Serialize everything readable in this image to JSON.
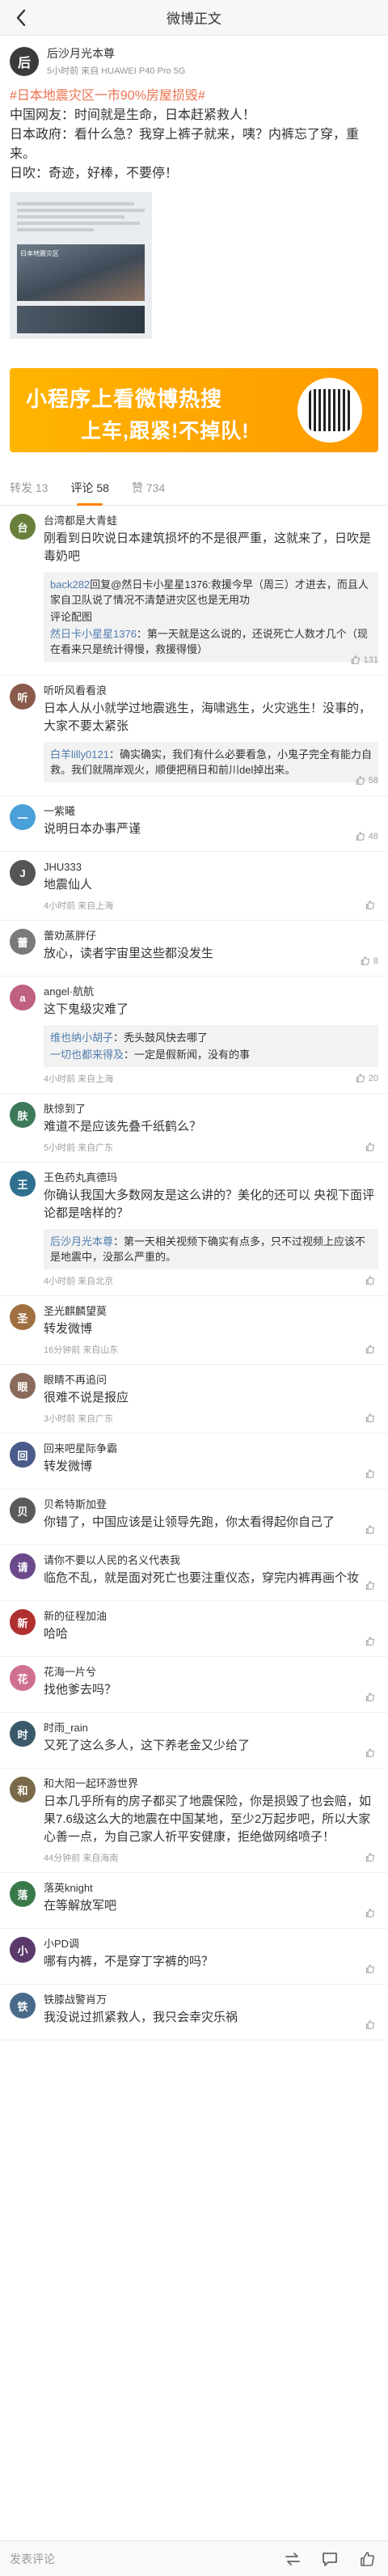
{
  "nav": {
    "title": "微博正文"
  },
  "post": {
    "author": "后沙月光本尊",
    "avatar_color": "#3b3b3b",
    "meta": "5小时前 来自 HUAWEI P40 Pro 5G",
    "hashtag": "#日本地震灾区一市90%房屋损毁#",
    "lines": [
      "中国网友：时间就是生命，日本赶紧救人！",
      "日本政府：看什么急？我穿上裤子就来，咦？内裤忘了穿，重来。",
      "日吹：奇迹，好棒，不要停！"
    ],
    "image_label": "日本地震灾区"
  },
  "banner": {
    "line1": "小程序上看微博热搜",
    "line2": "上车,跟紧!不掉队!"
  },
  "tabs": [
    {
      "label": "转发 13"
    },
    {
      "label": "评论 58"
    },
    {
      "label": "赞 734"
    }
  ],
  "comments": [
    {
      "name": "台湾都是大青蛙",
      "avatar": "#6a7f3c",
      "text": "刚看到日吹说日本建筑损坏的不是很严重，这就来了，日吹是毒奶吧",
      "time": "",
      "like": "131",
      "replies": [
        {
          "name": "back282",
          "text": "回复@然日卡小星星1376:救援今早（周三）才进去，而且人家自卫队说了情况不清楚进灾区也是无用功"
        },
        {
          "name": "",
          "text": "评论配图"
        },
        {
          "name": "然日卡小星星1376",
          "text": "：第一天就是这么说的，还说死亡人数才几个（现在看来只是统计得慢，救援得慢）"
        }
      ]
    },
    {
      "name": "听听风看看浪",
      "avatar": "#8a5a4a",
      "text": "日本人从小就学过地震逃生，海啸逃生，火灾逃生！没事的，大家不要太紧张",
      "time": "",
      "like": "58",
      "replies": [
        {
          "name": "白羊lilly0121",
          "text": "：确实确实，我们有什么必要看急，小鬼子完全有能力自救。我们就隔岸观火，顺便把稍日和前川del掉出来。"
        }
      ]
    },
    {
      "name": "一紫曦",
      "avatar": "#4aa0d8",
      "text": "说明日本办事严谨",
      "time": "",
      "like": "48",
      "replies": []
    },
    {
      "name": "JHU333",
      "avatar": "#555555",
      "text": "地震仙人",
      "time": "4小时前 来自上海",
      "like": "",
      "replies": []
    },
    {
      "name": "蕾劝蒸胖仔",
      "avatar": "#7a7a7a",
      "text": "放心，读者宇宙里这些都没发生",
      "time": "",
      "like": "8",
      "replies": []
    },
    {
      "name": "angel·航航",
      "avatar": "#c06080",
      "text": "这下鬼级灾难了",
      "time": "4小时前 来自上海",
      "like": "20",
      "replies": [
        {
          "name": "维也纳小胡子",
          "text": "：秃头鼓风快去哪了"
        },
        {
          "name": "一切也都来得及",
          "text": "：一定是假新闻，没有的事"
        }
      ]
    },
    {
      "name": "肤惊到了",
      "avatar": "#3c7a5a",
      "text": "难道不是应该先叠千纸鹤么？",
      "time": "5小时前 来自广东",
      "like": "",
      "replies": []
    },
    {
      "name": "王色药丸真德玛",
      "avatar": "#2f6f8f",
      "text": "你确认我国大多数网友是这么讲的？美化的还可以 央视下面评论都是啥样的？",
      "time": "4小时前 来自北京",
      "like": "",
      "replies": [
        {
          "name": "后沙月光本尊",
          "text": "：第一天相关视频下确实有点多，只不过视频上应该不是地震中，没那么严重的。"
        }
      ]
    },
    {
      "name": "圣光麒麟望莫",
      "avatar": "#a07040",
      "text": "转发微博",
      "time": "16分钟前 来自山东",
      "like": "",
      "replies": []
    },
    {
      "name": "眼睛不再追问",
      "avatar": "#8a6a5a",
      "text": "很难不说是报应",
      "time": "3小时前 来自广东",
      "like": "",
      "replies": []
    },
    {
      "name": "回来吧星际争霸",
      "avatar": "#4a5a8a",
      "text": "转发微博",
      "time": "",
      "like": "",
      "replies": []
    },
    {
      "name": "贝希特斯加登",
      "avatar": "#5a5a5a",
      "text": "你错了，中国应该是让领导先跑，你太看得起你自己了",
      "time": "",
      "like": "",
      "replies": []
    },
    {
      "name": "请你不要以人民的名义代表我",
      "avatar": "#6a4a8a",
      "text": "临危不乱，就是面对死亡也要注重仪态，穿完内裤再画个妆",
      "time": "",
      "like": "",
      "replies": []
    },
    {
      "name": "新的征程加油",
      "avatar": "#b03030",
      "text": "哈哈",
      "time": "",
      "like": "",
      "replies": []
    },
    {
      "name": "花海一片兮",
      "avatar": "#d07090",
      "text": "找他爹去吗？",
      "time": "",
      "like": "",
      "replies": []
    },
    {
      "name": "时雨_rain",
      "avatar": "#3a5a6a",
      "text": "又死了这么多人，这下养老金又少给了",
      "time": "",
      "like": "",
      "replies": []
    },
    {
      "name": "和大阳一起环游世界",
      "avatar": "#7a6a4a",
      "text": "日本几乎所有的房子都买了地震保险，你是损毁了也会赔，如果7.6级这么大的地震在中国某地，至少2万起步吧，所以大家心善一点，为自己家人祈平安健康，拒绝做网络喷子！",
      "time": "44分钟前 来自海南",
      "like": "",
      "replies": []
    },
    {
      "name": "落英knight",
      "avatar": "#3a7a4a",
      "text": "在等解放军吧",
      "time": "",
      "like": "",
      "replies": []
    },
    {
      "name": "小PD调",
      "avatar": "#5a3a6a",
      "text": "哪有内裤，不是穿丁字裤的吗？",
      "time": "",
      "like": "",
      "replies": []
    },
    {
      "name": "铁膝战警肖万",
      "avatar": "#4a6a8a",
      "text": "我没说过抓紧救人，我只会幸灾乐祸",
      "time": "",
      "like": "",
      "replies": []
    }
  ],
  "bottom": {
    "input_placeholder": "发表评论"
  }
}
